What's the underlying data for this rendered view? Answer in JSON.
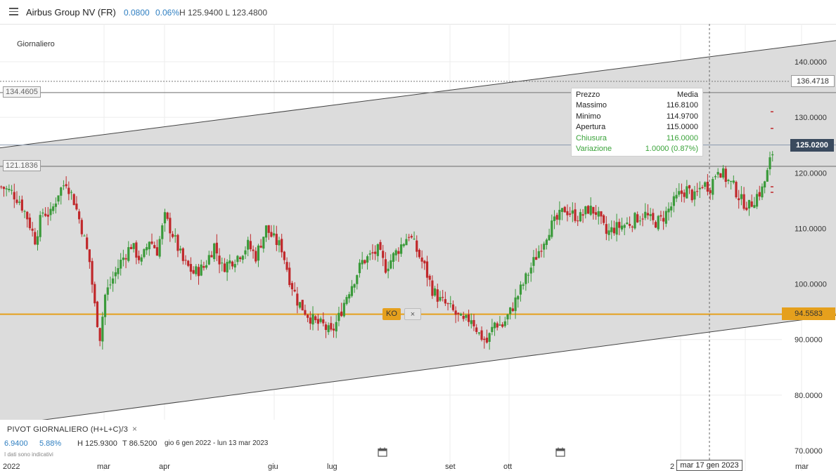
{
  "header": {
    "instrument": "Airbus Group NV (FR)",
    "change_abs": "0.0800",
    "change_pct": "0.06%",
    "high_low": "H 125.9400 L 123.4800"
  },
  "timeframe_label": "Giornaliero",
  "levels": {
    "left_upper": "134.4605",
    "left_lower": "121.1836",
    "right_upper": "136.4718",
    "current_price": "125.0200",
    "ko_price": "94.5583",
    "ko_label": "KO",
    "ko_close": "×"
  },
  "ohlc_box": {
    "header_k": "Prezzo",
    "header_v": "Media",
    "rows": [
      {
        "k": "Massimo",
        "v": "116.8100"
      },
      {
        "k": "Minimo",
        "v": "114.9700"
      },
      {
        "k": "Apertura",
        "v": "115.0000"
      },
      {
        "k": "Chiusura",
        "v": "116.0000"
      },
      {
        "k": "Variazione",
        "v": "1.0000 (0.87%)"
      }
    ]
  },
  "crosshair_label": "mar 17 gen 2023",
  "pivot": {
    "title": "PIVOT  GIORNALIERO  (H+L+C)/3",
    "close": "×",
    "v1": "6.9400",
    "v2": "5.88%",
    "high": "H  125.9300",
    "low": "T  86.5200",
    "range": "gio 6 gen 2022 - lun 13 mar 2023",
    "disclaimer": "I dati sono indicativi"
  },
  "colors": {
    "up": "#3a9a3a",
    "down": "#c0282b",
    "channel_fill": "#dcdcdc",
    "ko_line": "#e5a01d",
    "price_tag": "#3a4a5e"
  },
  "chart_data": {
    "type": "candlestick",
    "title": "",
    "x_start": "2022-01-06",
    "x_end": "2023-03-13",
    "ylim": [
      70,
      140
    ],
    "y_ticks": [
      "140.0000",
      "130.0000",
      "120.0000",
      "110.0000",
      "100.0000",
      "90.0000",
      "80.0000",
      "70.0000"
    ],
    "x_ticks": [
      "2022",
      "mar",
      "apr",
      "giu",
      "lug",
      "set",
      "ott",
      "2",
      "mar"
    ],
    "close_path": [
      [
        0,
        117.5
      ],
      [
        8,
        116.5
      ],
      [
        14,
        115
      ],
      [
        20,
        112
      ],
      [
        26,
        108
      ],
      [
        32,
        113
      ],
      [
        38,
        112.5
      ],
      [
        44,
        116.5
      ],
      [
        50,
        118.5
      ],
      [
        56,
        115
      ],
      [
        62,
        110
      ],
      [
        68,
        104
      ],
      [
        72,
        96
      ],
      [
        76,
        90.5
      ],
      [
        80,
        98
      ],
      [
        86,
        101
      ],
      [
        92,
        104
      ],
      [
        100,
        107
      ],
      [
        108,
        104
      ],
      [
        114,
        108
      ],
      [
        120,
        106
      ],
      [
        126,
        112
      ],
      [
        132,
        109
      ],
      [
        140,
        104
      ],
      [
        148,
        102
      ],
      [
        156,
        103
      ],
      [
        164,
        107
      ],
      [
        170,
        103
      ],
      [
        176,
        104
      ],
      [
        182,
        105
      ],
      [
        190,
        107
      ],
      [
        196,
        105
      ],
      [
        204,
        110
      ],
      [
        210,
        108
      ],
      [
        216,
        106.5
      ],
      [
        222,
        101
      ],
      [
        228,
        97
      ],
      [
        236,
        94.5
      ],
      [
        242,
        93
      ],
      [
        248,
        92.5
      ],
      [
        254,
        91
      ],
      [
        260,
        94
      ],
      [
        266,
        98
      ],
      [
        272,
        101
      ],
      [
        278,
        104
      ],
      [
        284,
        105
      ],
      [
        290,
        106
      ],
      [
        296,
        103
      ],
      [
        302,
        105
      ],
      [
        308,
        107
      ],
      [
        314,
        109
      ],
      [
        320,
        106
      ],
      [
        326,
        103
      ],
      [
        332,
        99
      ],
      [
        338,
        97
      ],
      [
        344,
        96
      ],
      [
        350,
        94.5
      ],
      [
        356,
        93
      ],
      [
        362,
        94
      ],
      [
        368,
        91
      ],
      [
        374,
        89.5
      ],
      [
        380,
        93
      ],
      [
        386,
        92.5
      ],
      [
        392,
        95
      ],
      [
        398,
        98
      ],
      [
        404,
        101
      ],
      [
        410,
        104
      ],
      [
        416,
        107
      ],
      [
        422,
        110
      ],
      [
        428,
        111.5
      ],
      [
        434,
        113.5
      ],
      [
        440,
        112.5
      ],
      [
        446,
        112
      ],
      [
        452,
        113.5
      ],
      [
        458,
        113
      ],
      [
        466,
        109
      ],
      [
        472,
        110
      ],
      [
        478,
        110.5
      ],
      [
        484,
        111
      ],
      [
        490,
        112
      ],
      [
        496,
        112.5
      ],
      [
        502,
        111
      ],
      [
        508,
        111.5
      ],
      [
        516,
        114
      ],
      [
        522,
        116
      ],
      [
        528,
        117
      ],
      [
        534,
        115.5
      ],
      [
        540,
        118
      ],
      [
        546,
        117.5
      ],
      [
        552,
        121
      ],
      [
        558,
        119
      ],
      [
        564,
        117.5
      ],
      [
        570,
        115
      ],
      [
        576,
        114
      ],
      [
        582,
        116
      ],
      [
        586,
        117
      ],
      [
        590,
        120
      ],
      [
        593,
        123
      ],
      [
        596,
        125.02
      ]
    ],
    "channel": {
      "upper": [
        [
          0,
          124.5
        ],
        [
          600,
          142.5
        ]
      ],
      "lower": [
        [
          0,
          74.5
        ],
        [
          600,
          93
        ]
      ]
    },
    "horizontal_levels": [
      136.4718,
      134.4605,
      125.02,
      121.1836,
      94.5583
    ]
  }
}
